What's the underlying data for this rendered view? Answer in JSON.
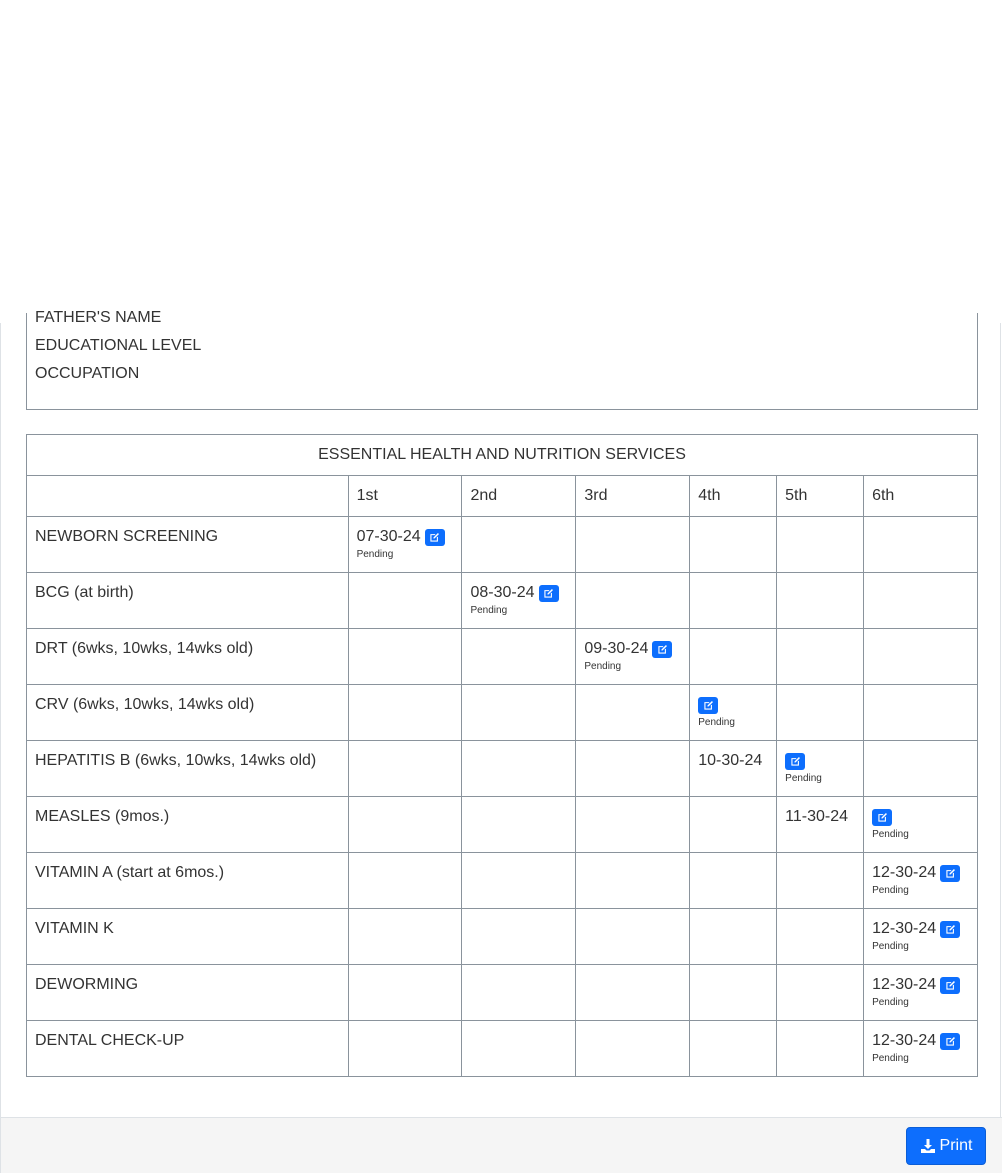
{
  "parent_info": {
    "fathers_name_label": "FATHER'S NAME",
    "educational_level_label": "EDUCATIONAL LEVEL",
    "occupation_label": "OCCUPATION"
  },
  "services_table": {
    "title": "ESSENTIAL HEALTH AND NUTRITION SERVICES",
    "dose_headers": [
      "1st",
      "2nd",
      "3rd",
      "4th",
      "5th",
      "6th"
    ],
    "rows": [
      {
        "label": "NEWBORN SCREENING",
        "cells": [
          {
            "date": "07-30-24",
            "edit": true,
            "status": "Pending"
          },
          null,
          null,
          null,
          null,
          null
        ]
      },
      {
        "label": "BCG (at birth)",
        "cells": [
          null,
          {
            "date": "08-30-24",
            "edit": true,
            "status": "Pending"
          },
          null,
          null,
          null,
          null
        ]
      },
      {
        "label": "DRT (6wks, 10wks, 14wks old)",
        "cells": [
          null,
          null,
          {
            "date": "09-30-24",
            "edit": true,
            "status": "Pending"
          },
          null,
          null,
          null
        ]
      },
      {
        "label": "CRV (6wks, 10wks, 14wks old)",
        "cells": [
          null,
          null,
          null,
          {
            "date": "",
            "edit": true,
            "status": "Pending"
          },
          null,
          null
        ]
      },
      {
        "label": "HEPATITIS B (6wks, 10wks, 14wks old)",
        "cells": [
          null,
          null,
          null,
          {
            "date": "10-30-24",
            "edit": false,
            "status": ""
          },
          {
            "date": "",
            "edit": true,
            "status": "Pending"
          },
          null
        ]
      },
      {
        "label": "MEASLES (9mos.)",
        "cells": [
          null,
          null,
          null,
          null,
          {
            "date": "11-30-24",
            "edit": false,
            "status": ""
          },
          {
            "date": "",
            "edit": true,
            "status": "Pending"
          }
        ]
      },
      {
        "label": "VITAMIN A (start at 6mos.)",
        "cells": [
          null,
          null,
          null,
          null,
          null,
          {
            "date": "12-30-24",
            "edit": true,
            "status": "Pending"
          }
        ]
      },
      {
        "label": "VITAMIN K",
        "cells": [
          null,
          null,
          null,
          null,
          null,
          {
            "date": "12-30-24",
            "edit": true,
            "status": "Pending"
          }
        ]
      },
      {
        "label": "DEWORMING",
        "cells": [
          null,
          null,
          null,
          null,
          null,
          {
            "date": "12-30-24",
            "edit": true,
            "status": "Pending"
          }
        ]
      },
      {
        "label": "DENTAL CHECK-UP",
        "cells": [
          null,
          null,
          null,
          null,
          null,
          {
            "date": "12-30-24",
            "edit": true,
            "status": "Pending"
          }
        ]
      }
    ]
  },
  "footer": {
    "print_label": "Print",
    "print_icon": "download-icon"
  },
  "colors": {
    "accent": "#0d6efd",
    "border": "#8a939c",
    "footer_bg": "#f5f5f5"
  }
}
